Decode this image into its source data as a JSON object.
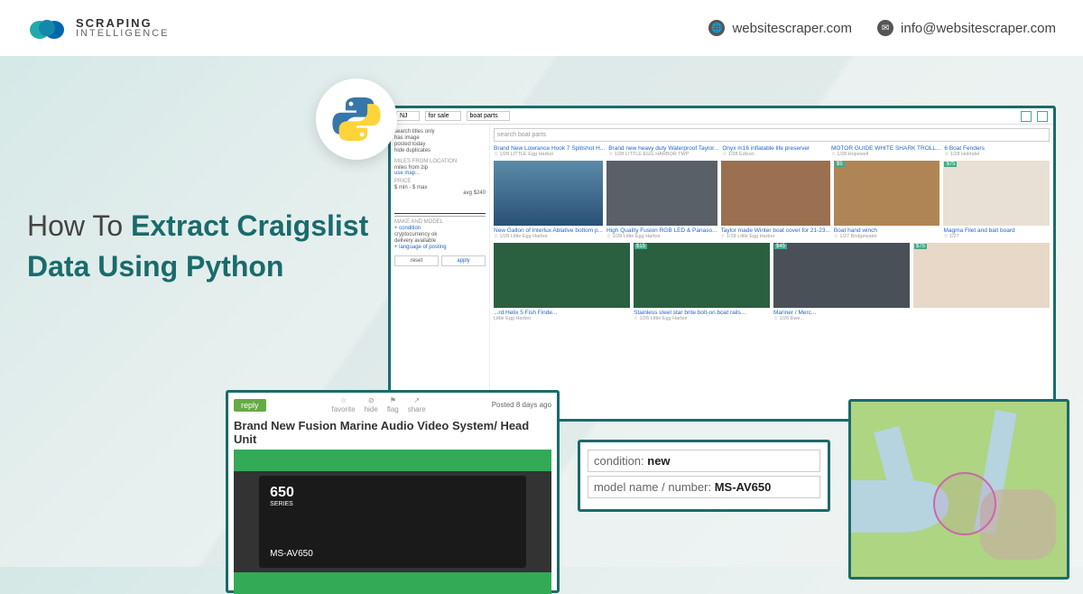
{
  "header": {
    "logo_line1": "SCRAPING",
    "logo_line2": "INTELLIGENCE",
    "website": "websitescraper.com",
    "email": "info@websitescraper.com"
  },
  "title": {
    "prefix": "How To ",
    "bold1": "Extract Craigslist",
    "bold2": "Data Using Python"
  },
  "browser": {
    "nav_region": "NJ",
    "nav_category": "for sale",
    "nav_sub": "boat parts",
    "search_placeholder": "search boat parts",
    "sidebar": {
      "search": "search titles...",
      "checks": [
        "search titles only",
        "has image",
        "posted today",
        "hide duplicates"
      ],
      "miles_head": "MILES FROM LOCATION",
      "miles_sub": "miles    from zip",
      "map_link": "use map...",
      "price_head": "PRICE",
      "price_sub": "$ min  - $ max",
      "avg": "avg $240",
      "make_head": "MAKE AND MODEL",
      "cond_link": "+ condition",
      "extra_checks": [
        "cryptocurrency ok",
        "delivery available"
      ],
      "lang_link": "+ language of posting",
      "btn_reset": "reset",
      "btn_apply": "apply"
    },
    "row1": [
      {
        "title": "Brand New Lowrance Hook 7 Splitshot H...",
        "sub": "☆ 1/28 LITTLE Egg Harbor"
      },
      {
        "title": "Brand new heavy duty Waterproof Taylor...",
        "sub": "☆ 1/28 LITTLE EGG HARBOR TWP"
      },
      {
        "title": "Onyx m16 inflatable life preserver",
        "sub": "☆ 1/28 Edison"
      },
      {
        "title": "MOTOR GUIDE WHITE SHARK TROLL...",
        "sub": "☆ 1/28 Hopewell"
      },
      {
        "title": "6 Boat Fenders",
        "sub": "☆ 1/28 Holmdel"
      }
    ],
    "row2": [
      {
        "title": "New Gallon of Interlux Ablative bottom p...",
        "sub": "☆ 1/28 Little Egg Harbor",
        "price": ""
      },
      {
        "title": "High Quality Fusion RGB LED & Panaso...",
        "sub": "☆ 1/28 Little Egg Harbor",
        "price": ""
      },
      {
        "title": "Taylor made Winter boat cover for 21-23...",
        "sub": "☆ 1/28 Little Egg Harbor",
        "price": ""
      },
      {
        "title": "Boat hand winch",
        "sub": "☆ 1/27 Bridgewater",
        "price": "$5"
      },
      {
        "title": "Magma Filet and bait board",
        "sub": "☆ 1/27",
        "price": "$75"
      }
    ],
    "row3": [
      {
        "title": "...rd Helix 5 Fish Finde...",
        "sub": "Little Egg Harbor",
        "price": ""
      },
      {
        "title": "Stainless steel star brite bolt-on boat rails...",
        "sub": "☆ 1/26 Little Egg Harbor",
        "price": "$15"
      },
      {
        "title": "Mariner / Merc...",
        "sub": "☆ 1/26 Ewe...",
        "price": "$45"
      },
      {
        "title": "",
        "sub": "",
        "price": "$75"
      }
    ]
  },
  "detail": {
    "reply": "reply",
    "actions": [
      "favorite",
      "hide",
      "flag",
      "share"
    ],
    "posted": "Posted 8 days ago",
    "title": "Brand New Fusion Marine Audio Video System/ Head Unit",
    "box_num": "650",
    "box_series": "SERIES",
    "box_model": "MS-AV650"
  },
  "condition": {
    "c_label": "condition: ",
    "c_value": "new",
    "m_label": "model name / number: ",
    "m_value": "MS-AV650"
  }
}
